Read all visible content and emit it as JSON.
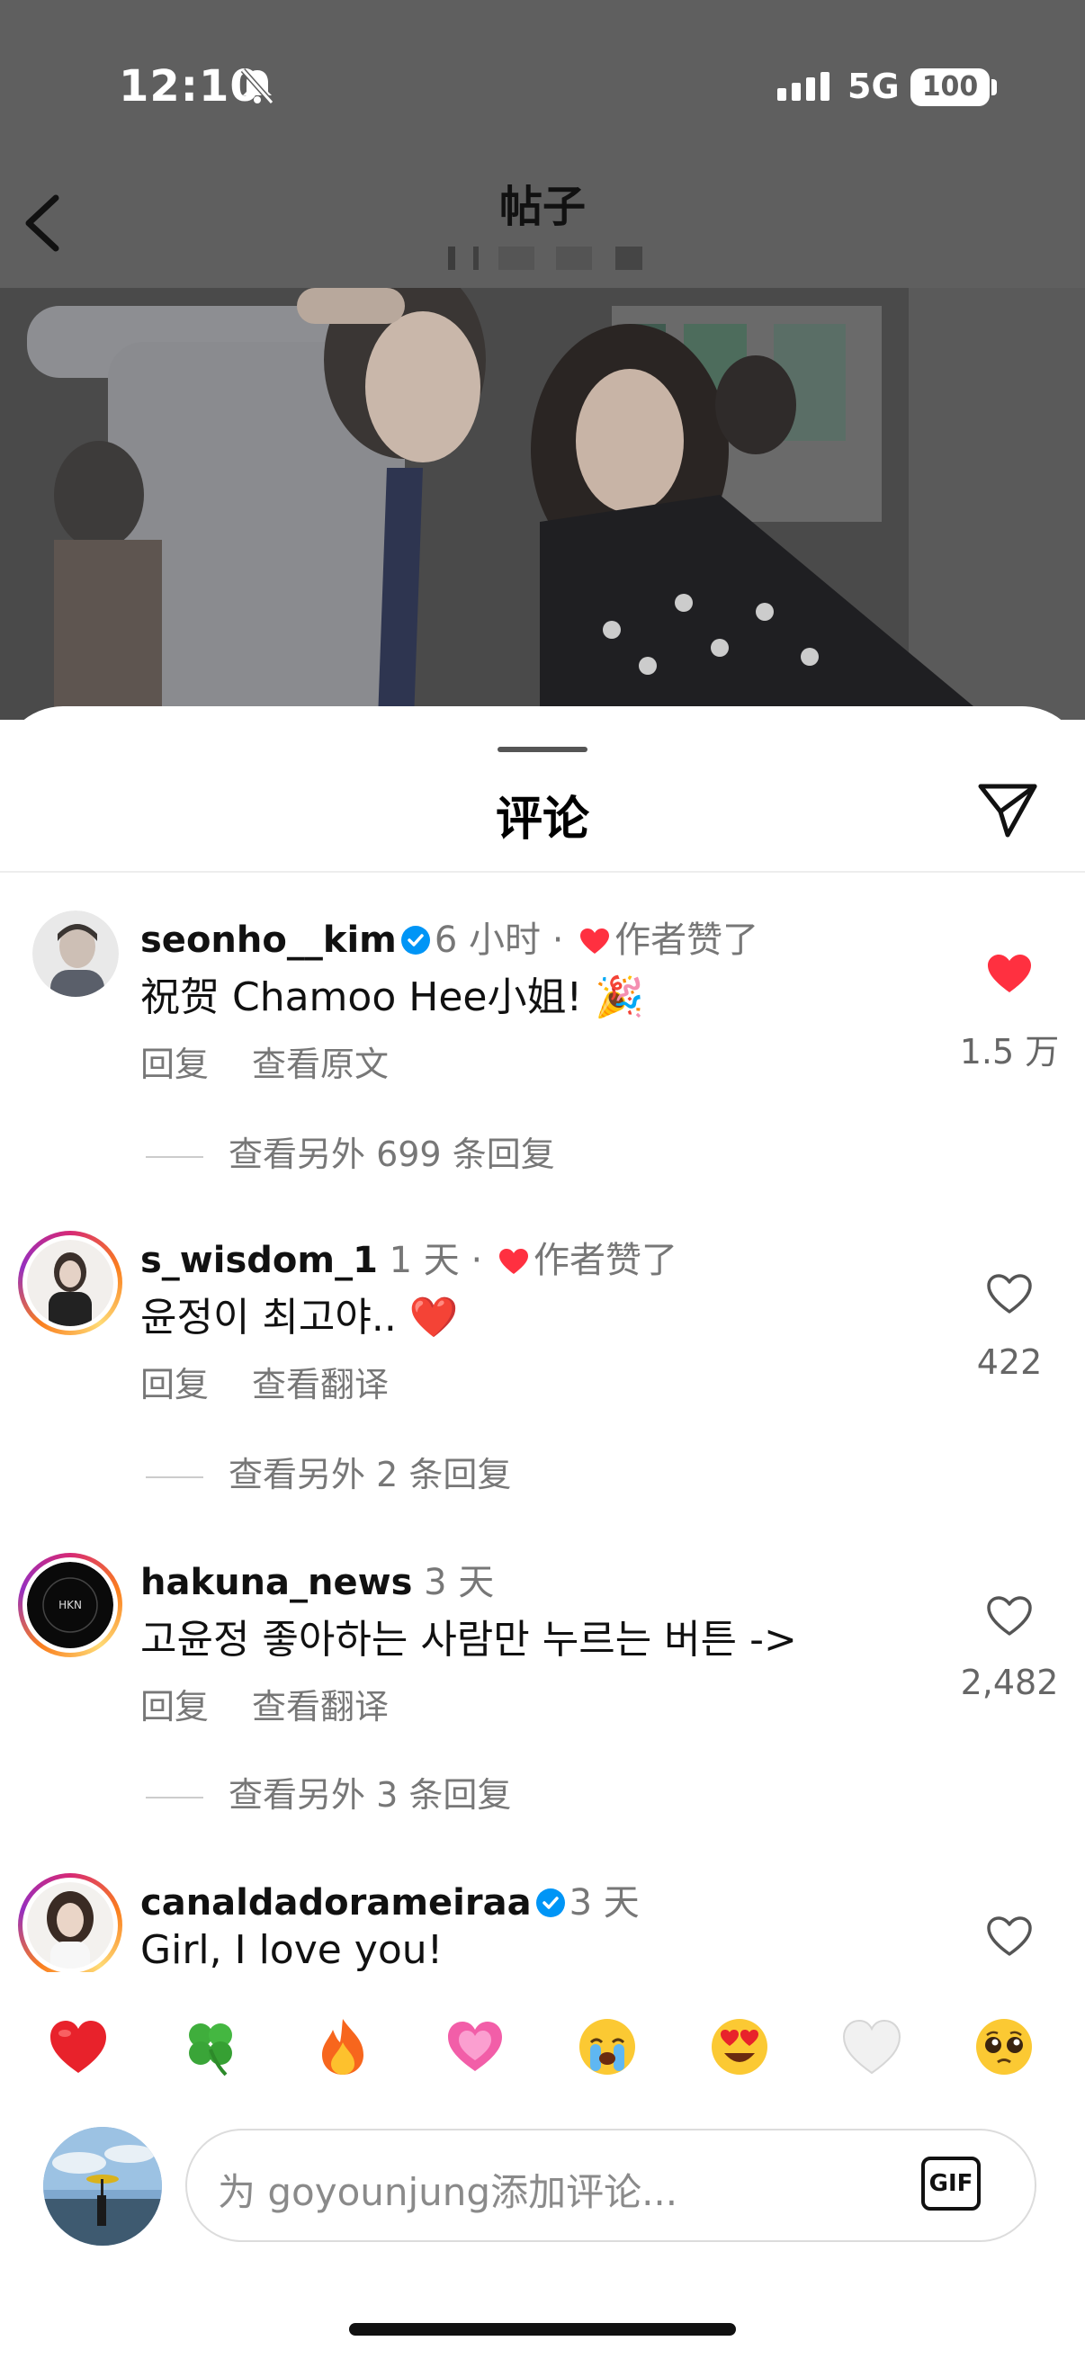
{
  "status_bar": {
    "time": "12:10",
    "network": "5G",
    "battery": "100"
  },
  "header": {
    "title": "帖子"
  },
  "comments_sheet": {
    "title": "评论",
    "comments": [
      {
        "username": "seonho__kim",
        "verified": true,
        "time": "6 小时",
        "author_liked": "作者赞了",
        "text": "祝贺 Chamoo Hee小姐! 🎉",
        "reply": "回复",
        "secondary": "查看原文",
        "likes": "1.5 万",
        "liked": true,
        "more_replies": "查看另外 699 条回复"
      },
      {
        "username": "s_wisdom_1",
        "verified": false,
        "time": "1 天",
        "author_liked": "作者赞了",
        "text": "윤정이 최고야.. ❤️",
        "reply": "回复",
        "secondary": "查看翻译",
        "likes": "422",
        "liked": false,
        "more_replies": "查看另外 2 条回复"
      },
      {
        "username": "hakuna_news",
        "verified": false,
        "time": "3 天",
        "author_liked": "",
        "text": "고윤정 좋아하는 사람만 누르는 버튼 ->",
        "reply": "回复",
        "secondary": "查看翻译",
        "likes": "2,482",
        "liked": false,
        "more_replies": "查看另外 3 条回复"
      },
      {
        "username": "canaldadorameiraa",
        "verified": true,
        "time": "3 天",
        "author_liked": "",
        "text": "Girl, I love you!",
        "liked": false
      }
    ]
  },
  "reaction_bar": {
    "emojis": [
      "heart",
      "four-leaf-clover",
      "fire",
      "sparkling-heart",
      "crying-face",
      "heart-eyes-face",
      "white-heart",
      "pleading-face"
    ]
  },
  "composer": {
    "placeholder": "为 goyounjung添加评论...",
    "gif_label": "GIF"
  },
  "colors": {
    "like_red": "#ff3040",
    "verified_blue": "#0095f6",
    "meta_gray": "#777777"
  }
}
